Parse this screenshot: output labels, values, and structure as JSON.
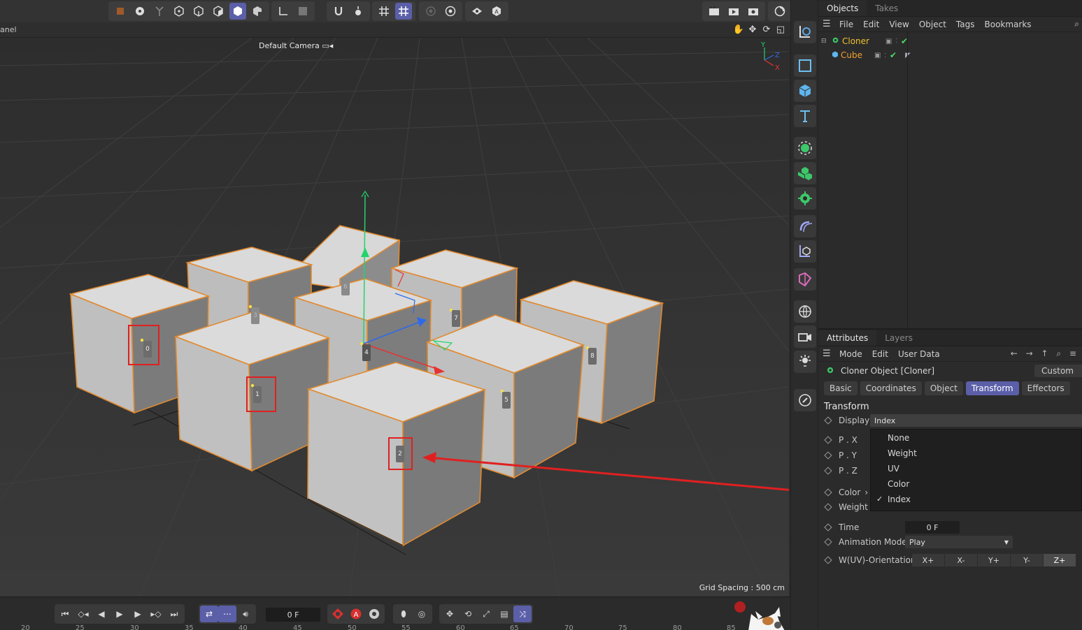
{
  "viewport": {
    "panel_label": "anel",
    "camera_label": "Default Camera",
    "grid_spacing": "Grid Spacing : 500 cm",
    "axis_labels": {
      "y": "Y",
      "z": "Z",
      "x": "X"
    },
    "clone_indices": [
      "0",
      "1",
      "2",
      "3",
      "4",
      "5",
      "6",
      "7",
      "8"
    ]
  },
  "objects_panel": {
    "tabs": [
      "Objects",
      "Takes"
    ],
    "menu": [
      "File",
      "Edit",
      "View",
      "Object",
      "Tags",
      "Bookmarks"
    ],
    "items": [
      {
        "name": "Cloner"
      },
      {
        "name": "Cube"
      }
    ]
  },
  "attributes_panel": {
    "tabs": [
      "Attributes",
      "Layers"
    ],
    "menu": [
      "Mode",
      "Edit",
      "User Data"
    ],
    "object_title": "Cloner Object [Cloner]",
    "custom_label": "Custom",
    "section_tabs": [
      "Basic",
      "Coordinates",
      "Object",
      "Transform",
      "Effectors"
    ],
    "active_section_tab": "Transform",
    "section_title": "Transform",
    "properties": {
      "display_label": "Display",
      "display_value": "Index",
      "px_label": "P . X",
      "py_label": "P . Y",
      "pz_label": "P . Z",
      "color_label": "Color",
      "weight_label": "Weight",
      "time_label": "Time",
      "time_value": "0 F",
      "animation_mode_label": "Animation Mode",
      "animation_mode_value": "Play",
      "orientation_label": "W(UV)-Orientation",
      "orientation_options": [
        "X+",
        "X-",
        "Y+",
        "Y-",
        "Z+"
      ],
      "orientation_selected": "Z+"
    },
    "display_dropdown": {
      "options": [
        "None",
        "Weight",
        "UV",
        "Color",
        "Index"
      ],
      "selected": "Index"
    }
  },
  "timeline": {
    "current_frame": "0 F",
    "ruler_ticks": [
      "20",
      "25",
      "30",
      "35",
      "40",
      "45",
      "50",
      "55",
      "60",
      "65",
      "70",
      "75",
      "80",
      "85"
    ]
  },
  "colors": {
    "accent": "#5b5fa8",
    "cloner_text": "#f0c030",
    "cube_text": "#f0a030",
    "annotation_red": "#e02020",
    "selection_outline": "#e08a30"
  }
}
